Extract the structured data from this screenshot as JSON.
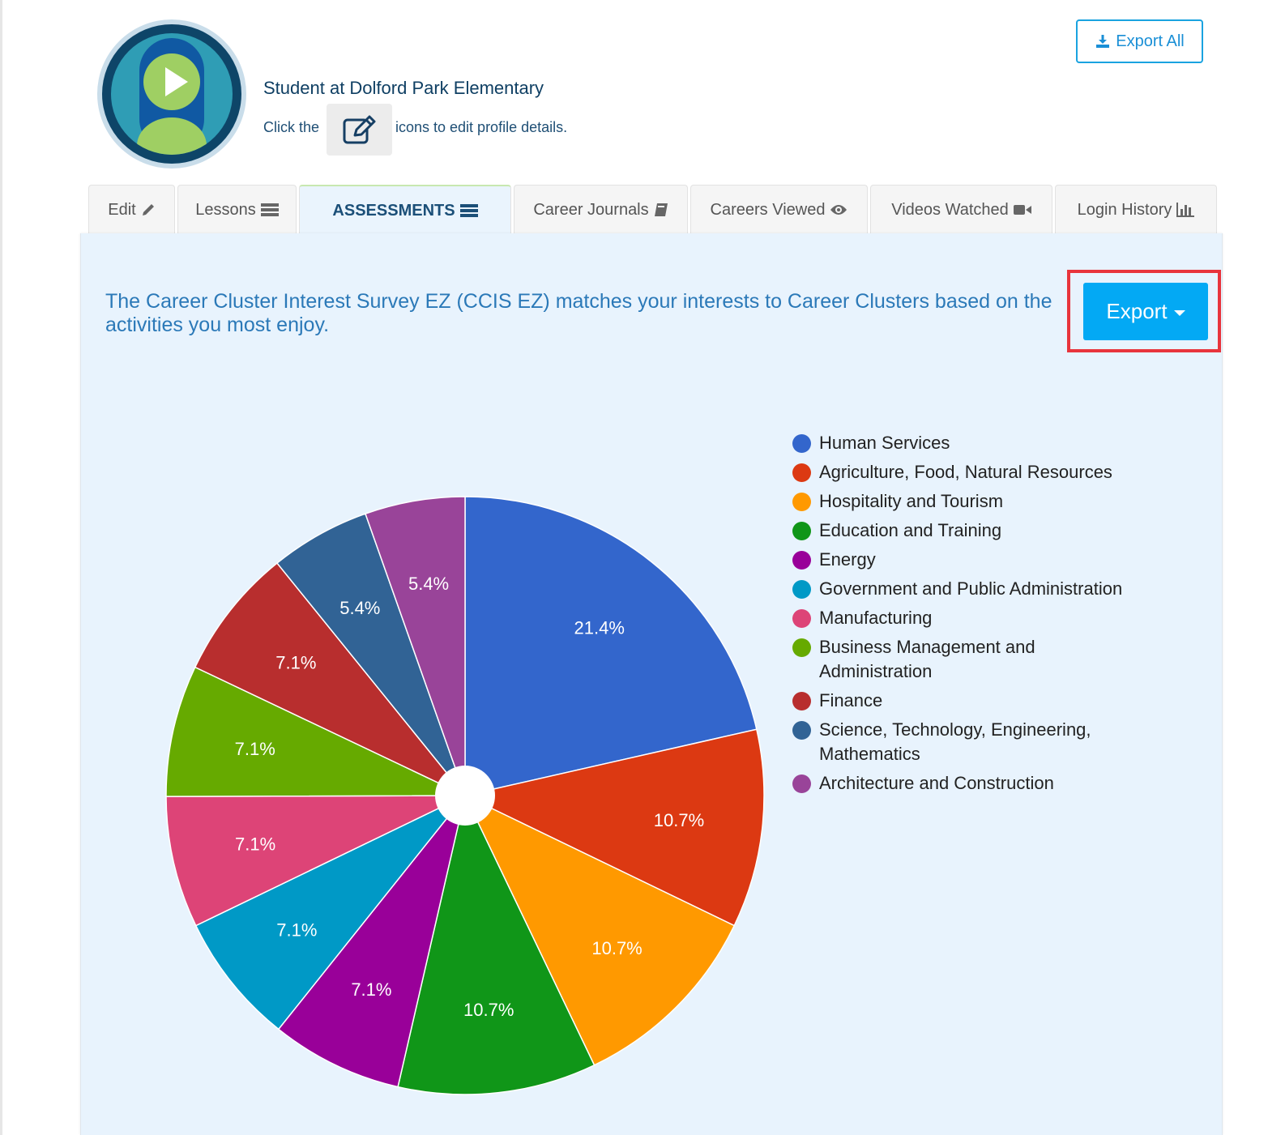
{
  "profile": {
    "title": "Student at Dolford Park Elementary",
    "hint_pre": "Click the",
    "hint_post": "icons to edit profile details."
  },
  "header": {
    "export_all_label": "Export All"
  },
  "tabs": [
    {
      "label": "Edit",
      "icon": "pencil-icon"
    },
    {
      "label": "Lessons",
      "icon": "list-icon"
    },
    {
      "label": "ASSESSMENTS",
      "icon": "list-icon",
      "active": true
    },
    {
      "label": "Career Journals",
      "icon": "book-icon"
    },
    {
      "label": "Careers Viewed",
      "icon": "eye-icon"
    },
    {
      "label": "Videos Watched",
      "icon": "video-camera-icon"
    },
    {
      "label": "Login History",
      "icon": "bar-chart-icon"
    }
  ],
  "panel": {
    "intro": "The Career Cluster Interest Survey EZ (CCIS EZ) matches your interests to Career Clusters based on the activities you most enjoy.",
    "export_label": "Export"
  },
  "chart_data": {
    "type": "pie",
    "categories": [
      "Human Services",
      "Agriculture, Food, Natural Resources",
      "Hospitality and Tourism",
      "Education and Training",
      "Energy",
      "Government and Public Administration",
      "Manufacturing",
      "Business Management and Administration",
      "Finance",
      "Science, Technology, Engineering, Mathematics",
      "Architecture and Construction"
    ],
    "values": [
      21.4,
      10.7,
      10.7,
      10.7,
      7.1,
      7.1,
      7.1,
      7.1,
      7.1,
      5.4,
      5.4
    ],
    "labels": [
      "21.4%",
      "10.7%",
      "10.7%",
      "10.7%",
      "7.1%",
      "7.1%",
      "7.1%",
      "7.1%",
      "7.1%",
      "5.4%",
      "5.4%"
    ],
    "colors": [
      "#3366cc",
      "#dc3912",
      "#ff9900",
      "#109618",
      "#990099",
      "#0099c6",
      "#dd4477",
      "#66aa00",
      "#b82e2e",
      "#316395",
      "#994499"
    ],
    "legend_position": "right",
    "donut_hole": true
  }
}
